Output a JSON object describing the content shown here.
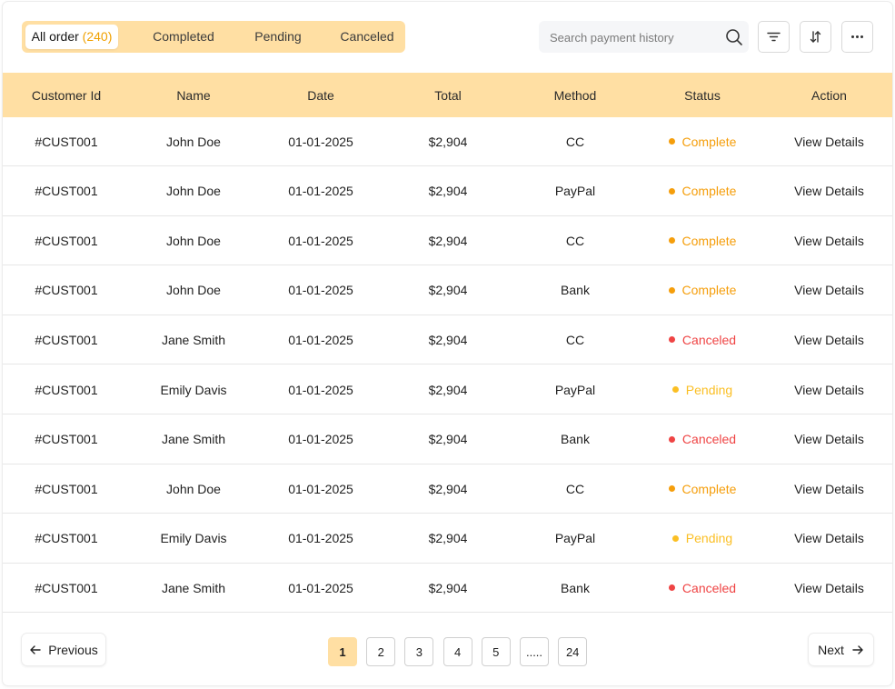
{
  "tabs": [
    {
      "label": "All order",
      "count": "(240)",
      "active": true
    },
    {
      "label": "Completed"
    },
    {
      "label": "Pending"
    },
    {
      "label": "Canceled"
    }
  ],
  "search": {
    "placeholder": "Search payment history",
    "value": ""
  },
  "toolbar": {
    "filter_icon": "filter-icon",
    "sort_icon": "sort-icon",
    "more_icon": "more-icon"
  },
  "table": {
    "columns": [
      "Customer Id",
      "Name",
      "Date",
      "Total",
      "Method",
      "Status",
      "Action"
    ],
    "rows": [
      {
        "id": "#CUST001",
        "name": "John Doe",
        "date": "01-01-2025",
        "total": "$2,904",
        "method": "CC",
        "status": "Complete",
        "action": "View Details"
      },
      {
        "id": "#CUST001",
        "name": "John Doe",
        "date": "01-01-2025",
        "total": "$2,904",
        "method": "PayPal",
        "status": "Complete",
        "action": "View Details"
      },
      {
        "id": "#CUST001",
        "name": "John Doe",
        "date": "01-01-2025",
        "total": "$2,904",
        "method": "CC",
        "status": "Complete",
        "action": "View Details"
      },
      {
        "id": "#CUST001",
        "name": "John Doe",
        "date": "01-01-2025",
        "total": "$2,904",
        "method": "Bank",
        "status": "Complete",
        "action": "View Details"
      },
      {
        "id": "#CUST001",
        "name": "Jane Smith",
        "date": "01-01-2025",
        "total": "$2,904",
        "method": "CC",
        "status": "Canceled",
        "action": "View Details"
      },
      {
        "id": "#CUST001",
        "name": "Emily Davis",
        "date": "01-01-2025",
        "total": "$2,904",
        "method": "PayPal",
        "status": "Pending",
        "action": "View Details"
      },
      {
        "id": "#CUST001",
        "name": "Jane Smith",
        "date": "01-01-2025",
        "total": "$2,904",
        "method": "Bank",
        "status": "Canceled",
        "action": "View Details"
      },
      {
        "id": "#CUST001",
        "name": "John Doe",
        "date": "01-01-2025",
        "total": "$2,904",
        "method": "CC",
        "status": "Complete",
        "action": "View Details"
      },
      {
        "id": "#CUST001",
        "name": "Emily Davis",
        "date": "01-01-2025",
        "total": "$2,904",
        "method": "PayPal",
        "status": "Pending",
        "action": "View Details"
      },
      {
        "id": "#CUST001",
        "name": "Jane Smith",
        "date": "01-01-2025",
        "total": "$2,904",
        "method": "Bank",
        "status": "Canceled",
        "action": "View Details"
      }
    ]
  },
  "status_colors": {
    "Complete": "#f59e0b",
    "Pending": "#fbbf24",
    "Canceled": "#ef4444"
  },
  "pagination": {
    "previous_label": "Previous",
    "next_label": "Next",
    "pages": [
      "1",
      "2",
      "3",
      "4",
      "5",
      ".....",
      "24"
    ],
    "current": "1"
  },
  "colors": {
    "accent": "#ffdfa3",
    "count": "#f0a000"
  }
}
